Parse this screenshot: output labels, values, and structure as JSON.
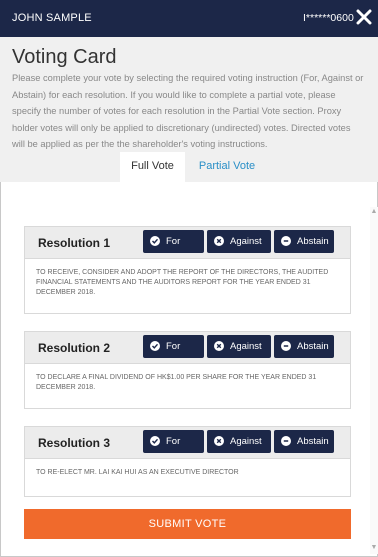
{
  "topbar": {
    "user": "JOHN SAMPLE",
    "account": "I******0600",
    "close_icon": "close-icon"
  },
  "card": {
    "title": "Voting Card",
    "intro": "Please complete your vote by selecting the required voting instruction (For, Against or Abstain) for each resolution. If you would like to complete a partial vote, please specify the number of votes for each resolution in the Partial Vote section. Proxy holder votes will only be applied to discretionary (undirected) votes. Directed votes will be applied as per the the shareholder's voting instructions."
  },
  "tabs": [
    {
      "label": "Full Vote",
      "active": true
    },
    {
      "label": "Partial Vote",
      "active": false
    }
  ],
  "vote_options": {
    "for": "For",
    "against": "Against",
    "abstain": "Abstain"
  },
  "resolutions": [
    {
      "name": "Resolution 1",
      "text": "TO RECEIVE, CONSIDER AND ADOPT THE REPORT OF THE DIRECTORS, THE AUDITED FINANCIAL STATEMENTS AND THE AUDITORS REPORT FOR THE YEAR ENDED 31 DECEMBER 2018."
    },
    {
      "name": "Resolution 2",
      "text": "TO DECLARE A FINAL DIVIDEND OF HK$1.00 PER SHARE FOR THE YEAR ENDED 31 DECEMBER 2018."
    },
    {
      "name": "Resolution 3",
      "text": "TO RE-ELECT MR. LAI KAI HUI AS AN EXECUTIVE DIRECTOR"
    }
  ],
  "submit_label": "SUBMIT VOTE",
  "colors": {
    "navy": "#1c2748",
    "accent": "#f06a2c",
    "link": "#2a8fc7"
  }
}
